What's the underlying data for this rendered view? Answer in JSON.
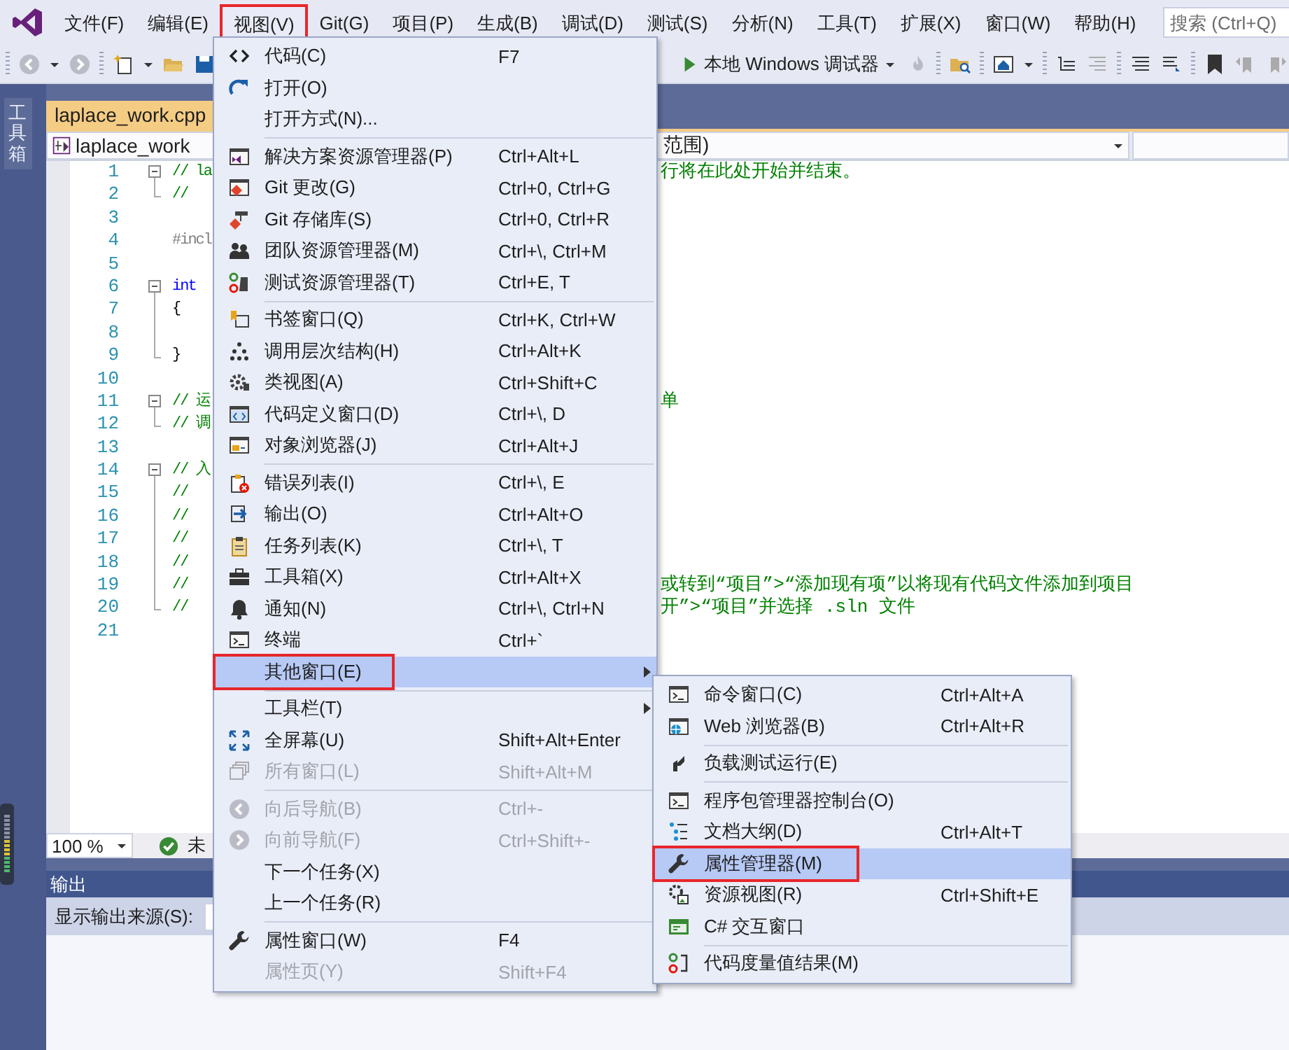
{
  "menubar": {
    "items": [
      {
        "label": "文件(F)",
        "open": false,
        "outlined": false
      },
      {
        "label": "编辑(E)",
        "open": false,
        "outlined": false
      },
      {
        "label": "视图(V)",
        "open": true,
        "outlined": true
      },
      {
        "label": "Git(G)",
        "open": false,
        "outlined": false
      },
      {
        "label": "项目(P)",
        "open": false,
        "outlined": false
      },
      {
        "label": "生成(B)",
        "open": false,
        "outlined": false
      },
      {
        "label": "调试(D)",
        "open": false,
        "outlined": false
      },
      {
        "label": "测试(S)",
        "open": false,
        "outlined": false
      },
      {
        "label": "分析(N)",
        "open": false,
        "outlined": false
      },
      {
        "label": "工具(T)",
        "open": false,
        "outlined": false
      },
      {
        "label": "扩展(X)",
        "open": false,
        "outlined": false
      },
      {
        "label": "窗口(W)",
        "open": false,
        "outlined": false
      },
      {
        "label": "帮助(H)",
        "open": false,
        "outlined": false
      }
    ],
    "search": {
      "placeholder": "搜索 (Ctrl+Q)"
    }
  },
  "toolbar": {
    "debug_target": "本地 Windows 调试器"
  },
  "toolbox_tab": {
    "label": "工具箱"
  },
  "editor": {
    "tab": {
      "label": "laplace_work.cpp",
      "selected": true
    },
    "nav": {
      "project": "laplace_work",
      "scope": "范围)"
    },
    "lines": [
      {
        "number": "1",
        "left": "// la",
        "right": "行将在此处开始并结束。",
        "kind": "comment",
        "fold_toggle": true,
        "fold_guide": false,
        "fold_end": false
      },
      {
        "number": "2",
        "left": "//",
        "kind": "comment",
        "fold_toggle": false,
        "fold_guide": false,
        "fold_end": true
      },
      {
        "number": "3",
        "fold_toggle": false,
        "fold_guide": false,
        "fold_end": false
      },
      {
        "number": "4",
        "left": "#incl",
        "kind": "preprocessor",
        "fold_toggle": false,
        "fold_guide": false,
        "fold_end": false
      },
      {
        "number": "5",
        "fold_toggle": false,
        "fold_guide": false,
        "fold_end": false
      },
      {
        "number": "6",
        "left": "int",
        "kind": "keyword",
        "fold_toggle": true,
        "fold_guide": false,
        "fold_end": false
      },
      {
        "number": "7",
        "left": "{",
        "kind": "plain",
        "fold_toggle": false,
        "fold_guide": true,
        "fold_end": false
      },
      {
        "number": "8",
        "fold_toggle": false,
        "fold_guide": true,
        "fold_end": false
      },
      {
        "number": "9",
        "left": "}",
        "kind": "plain",
        "fold_toggle": false,
        "fold_guide": false,
        "fold_end": true
      },
      {
        "number": "10",
        "fold_toggle": false,
        "fold_guide": false,
        "fold_end": false
      },
      {
        "number": "11",
        "left": "// 运",
        "right": "单",
        "kind": "comment",
        "fold_toggle": true,
        "fold_guide": false,
        "fold_end": false
      },
      {
        "number": "12",
        "left": "// 调",
        "kind": "comment",
        "fold_toggle": false,
        "fold_guide": false,
        "fold_end": true
      },
      {
        "number": "13",
        "fold_toggle": false,
        "fold_guide": false,
        "fold_end": false
      },
      {
        "number": "14",
        "left": "// 入",
        "kind": "comment",
        "fold_toggle": true,
        "fold_guide": false,
        "fold_end": false
      },
      {
        "number": "15",
        "left": "//",
        "kind": "comment",
        "fold_toggle": false,
        "fold_guide": true,
        "fold_end": false
      },
      {
        "number": "16",
        "left": "//",
        "kind": "comment",
        "fold_toggle": false,
        "fold_guide": true,
        "fold_end": false
      },
      {
        "number": "17",
        "left": "//",
        "kind": "comment",
        "fold_toggle": false,
        "fold_guide": true,
        "fold_end": false
      },
      {
        "number": "18",
        "left": "//",
        "kind": "comment",
        "fold_toggle": false,
        "fold_guide": true,
        "fold_end": false
      },
      {
        "number": "19",
        "left": "//",
        "right": "或转到“项目”>“添加现有项”以将现有代码文件添加到项目",
        "kind": "comment",
        "fold_toggle": false,
        "fold_guide": true,
        "fold_end": false
      },
      {
        "number": "20",
        "left": "//",
        "right": "开”>“项目”并选择 .sln 文件",
        "kind": "comment",
        "fold_toggle": false,
        "fold_guide": false,
        "fold_end": true
      },
      {
        "number": "21",
        "fold_toggle": false,
        "fold_guide": false,
        "fold_end": false
      }
    ],
    "zoom": "100 %",
    "status": "未"
  },
  "output": {
    "title": "输出",
    "source_label": "显示输出来源(S):"
  },
  "view_menu": {
    "items": [
      {
        "kind": "item",
        "label": "代码(C)",
        "shortcut": "F7",
        "disabled": false,
        "highlighted": false,
        "outlined": false,
        "submenu": false
      },
      {
        "kind": "item",
        "label": "打开(O)",
        "disabled": false,
        "highlighted": false,
        "outlined": false,
        "submenu": false
      },
      {
        "kind": "item",
        "label": "打开方式(N)...",
        "disabled": false,
        "highlighted": false,
        "outlined": false,
        "submenu": false
      },
      {
        "kind": "separator"
      },
      {
        "kind": "item",
        "label": "解决方案资源管理器(P)",
        "shortcut": "Ctrl+Alt+L",
        "disabled": false,
        "highlighted": false,
        "outlined": false,
        "submenu": false
      },
      {
        "kind": "item",
        "label": "Git 更改(G)",
        "shortcut": "Ctrl+0, Ctrl+G",
        "disabled": false,
        "highlighted": false,
        "outlined": false,
        "submenu": false
      },
      {
        "kind": "item",
        "label": "Git 存储库(S)",
        "shortcut": "Ctrl+0, Ctrl+R",
        "disabled": false,
        "highlighted": false,
        "outlined": false,
        "submenu": false
      },
      {
        "kind": "item",
        "label": "团队资源管理器(M)",
        "shortcut": "Ctrl+\\, Ctrl+M",
        "disabled": false,
        "highlighted": false,
        "outlined": false,
        "submenu": false
      },
      {
        "kind": "item",
        "label": "测试资源管理器(T)",
        "shortcut": "Ctrl+E, T",
        "disabled": false,
        "highlighted": false,
        "outlined": false,
        "submenu": false
      },
      {
        "kind": "separator"
      },
      {
        "kind": "item",
        "label": "书签窗口(Q)",
        "shortcut": "Ctrl+K, Ctrl+W",
        "disabled": false,
        "highlighted": false,
        "outlined": false,
        "submenu": false
      },
      {
        "kind": "item",
        "label": "调用层次结构(H)",
        "shortcut": "Ctrl+Alt+K",
        "disabled": false,
        "highlighted": false,
        "outlined": false,
        "submenu": false
      },
      {
        "kind": "item",
        "label": "类视图(A)",
        "shortcut": "Ctrl+Shift+C",
        "disabled": false,
        "highlighted": false,
        "outlined": false,
        "submenu": false
      },
      {
        "kind": "item",
        "label": "代码定义窗口(D)",
        "shortcut": "Ctrl+\\, D",
        "disabled": false,
        "highlighted": false,
        "outlined": false,
        "submenu": false
      },
      {
        "kind": "item",
        "label": "对象浏览器(J)",
        "shortcut": "Ctrl+Alt+J",
        "disabled": false,
        "highlighted": false,
        "outlined": false,
        "submenu": false
      },
      {
        "kind": "separator"
      },
      {
        "kind": "item",
        "label": "错误列表(I)",
        "shortcut": "Ctrl+\\, E",
        "disabled": false,
        "highlighted": false,
        "outlined": false,
        "submenu": false
      },
      {
        "kind": "item",
        "label": "输出(O)",
        "shortcut": "Ctrl+Alt+O",
        "disabled": false,
        "highlighted": false,
        "outlined": false,
        "submenu": false
      },
      {
        "kind": "item",
        "label": "任务列表(K)",
        "shortcut": "Ctrl+\\, T",
        "disabled": false,
        "highlighted": false,
        "outlined": false,
        "submenu": false
      },
      {
        "kind": "item",
        "label": "工具箱(X)",
        "shortcut": "Ctrl+Alt+X",
        "disabled": false,
        "highlighted": false,
        "outlined": false,
        "submenu": false
      },
      {
        "kind": "item",
        "label": "通知(N)",
        "shortcut": "Ctrl+\\, Ctrl+N",
        "disabled": false,
        "highlighted": false,
        "outlined": false,
        "submenu": false
      },
      {
        "kind": "item",
        "label": "终端",
        "shortcut": "Ctrl+`",
        "disabled": false,
        "highlighted": false,
        "outlined": false,
        "submenu": false
      },
      {
        "kind": "item",
        "label": "其他窗口(E)",
        "disabled": false,
        "highlighted": true,
        "outlined": true,
        "submenu": true
      },
      {
        "kind": "separator"
      },
      {
        "kind": "item",
        "label": "工具栏(T)",
        "disabled": false,
        "highlighted": false,
        "outlined": false,
        "submenu": true
      },
      {
        "kind": "item",
        "label": "全屏幕(U)",
        "shortcut": "Shift+Alt+Enter",
        "disabled": false,
        "highlighted": false,
        "outlined": false,
        "submenu": false
      },
      {
        "kind": "item",
        "label": "所有窗口(L)",
        "shortcut": "Shift+Alt+M",
        "disabled": true,
        "highlighted": false,
        "outlined": false,
        "submenu": false
      },
      {
        "kind": "separator"
      },
      {
        "kind": "item",
        "label": "向后导航(B)",
        "shortcut": "Ctrl+-",
        "disabled": true,
        "highlighted": false,
        "outlined": false,
        "submenu": false
      },
      {
        "kind": "item",
        "label": "向前导航(F)",
        "shortcut": "Ctrl+Shift+-",
        "disabled": true,
        "highlighted": false,
        "outlined": false,
        "submenu": false
      },
      {
        "kind": "item",
        "label": "下一个任务(X)",
        "disabled": false,
        "highlighted": false,
        "outlined": false,
        "submenu": false
      },
      {
        "kind": "item",
        "label": "上一个任务(R)",
        "disabled": false,
        "highlighted": false,
        "outlined": false,
        "submenu": false
      },
      {
        "kind": "separator"
      },
      {
        "kind": "item",
        "label": "属性窗口(W)",
        "shortcut": "F4",
        "disabled": false,
        "highlighted": false,
        "outlined": false,
        "submenu": false
      },
      {
        "kind": "item",
        "label": "属性页(Y)",
        "shortcut": "Shift+F4",
        "disabled": true,
        "highlighted": false,
        "outlined": false,
        "submenu": false
      }
    ]
  },
  "other_windows_menu": {
    "items": [
      {
        "kind": "item",
        "label": "命令窗口(C)",
        "shortcut": "Ctrl+Alt+A",
        "disabled": false,
        "highlighted": false,
        "outlined": false,
        "submenu": false
      },
      {
        "kind": "item",
        "label": "Web 浏览器(B)",
        "shortcut": "Ctrl+Alt+R",
        "disabled": false,
        "highlighted": false,
        "outlined": false,
        "submenu": false
      },
      {
        "kind": "separator"
      },
      {
        "kind": "item",
        "label": "负载测试运行(E)",
        "disabled": false,
        "highlighted": false,
        "outlined": false,
        "submenu": false
      },
      {
        "kind": "separator"
      },
      {
        "kind": "item",
        "label": "程序包管理器控制台(O)",
        "disabled": false,
        "highlighted": false,
        "outlined": false,
        "submenu": false
      },
      {
        "kind": "item",
        "label": "文档大纲(D)",
        "shortcut": "Ctrl+Alt+T",
        "disabled": false,
        "highlighted": false,
        "outlined": false,
        "submenu": false
      },
      {
        "kind": "item",
        "label": "属性管理器(M)",
        "disabled": false,
        "highlighted": true,
        "outlined": true,
        "submenu": false
      },
      {
        "kind": "item",
        "label": "资源视图(R)",
        "shortcut": "Ctrl+Shift+E",
        "disabled": false,
        "highlighted": false,
        "outlined": false,
        "submenu": false
      },
      {
        "kind": "item",
        "label": "C# 交互窗口",
        "disabled": false,
        "highlighted": false,
        "outlined": false,
        "submenu": false
      },
      {
        "kind": "separator"
      },
      {
        "kind": "item",
        "label": "代码度量值结果(M)",
        "disabled": false,
        "highlighted": false,
        "outlined": false,
        "submenu": false
      }
    ]
  }
}
